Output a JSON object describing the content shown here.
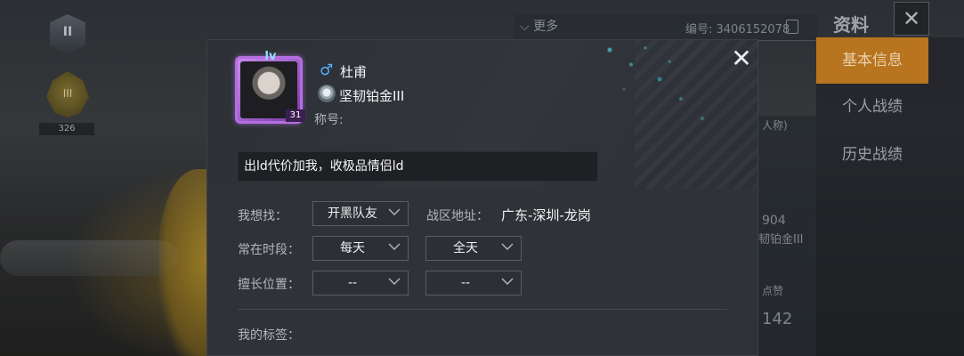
{
  "background": {
    "left_rank_badge_1": "II",
    "left_rank_badge_2": "III",
    "left_rank_score": "326",
    "more_label": "更多",
    "player_id": "编号: 3406152078",
    "panel_title": "资料",
    "panel_close": "✕",
    "side_menu": [
      {
        "label": "基本信息",
        "active": true
      },
      {
        "label": "个人战绩",
        "active": false
      },
      {
        "label": "历史战绩",
        "active": false
      }
    ],
    "mid_texts": [
      "人称)",
      "904",
      "韧铂金III",
      "点赞",
      "142"
    ]
  },
  "dialog": {
    "close_glyph": "✕",
    "avatar": {
      "badge": "lv",
      "level": "31"
    },
    "gender_symbol": "♂",
    "player_name": "杜甫",
    "rank_name": "坚韧铂金III",
    "title_label": "称号:",
    "signature": "出ld代价加我，收极品情侣ld",
    "form": {
      "looking_for_label": "我想找：",
      "looking_for_value": "开黑队友",
      "region_label": "战区地址：",
      "region_value": "广东-深圳-龙岗",
      "active_time_label": "常在时段：",
      "active_days_value": "每天",
      "active_hours_value": "全天",
      "position_label": "擅长位置：",
      "position_value_1": "--",
      "position_value_2": "--",
      "tags_label": "我的标签："
    }
  },
  "colors": {
    "accent_orange": "#b8741e",
    "avatar_frame_purple": "#b46ee0",
    "gender_blue": "#5ab0ff",
    "splatter_teal": "#46c8d2"
  }
}
